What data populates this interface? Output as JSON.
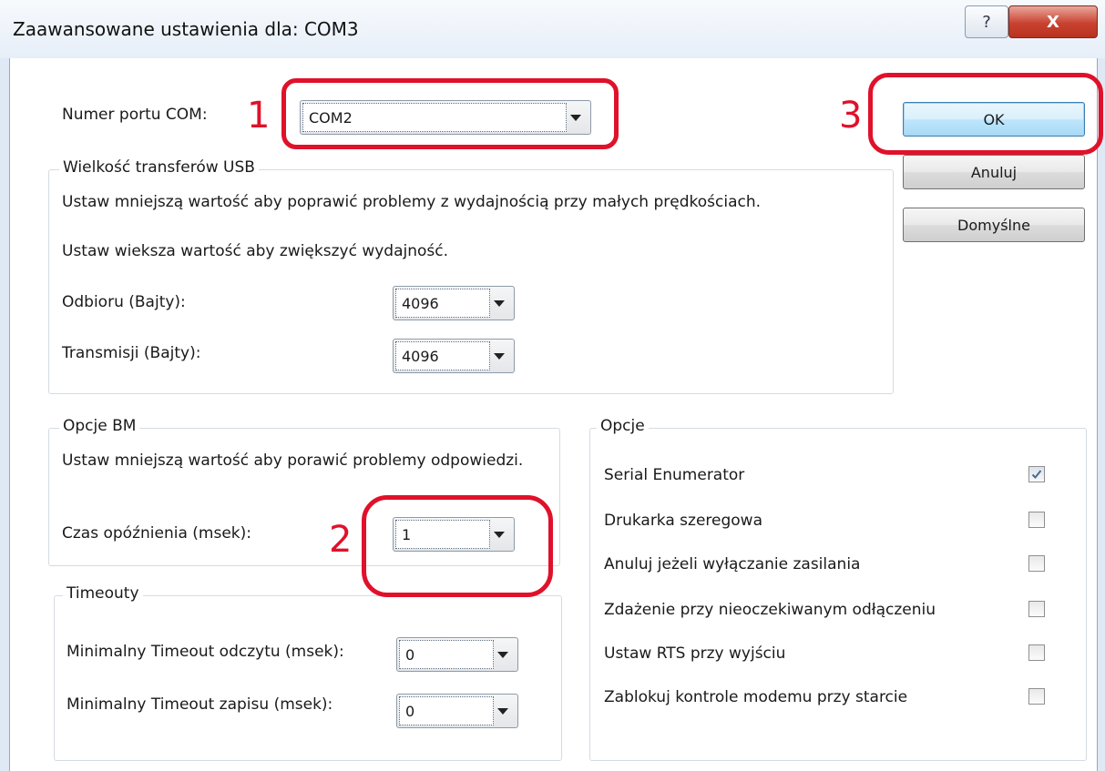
{
  "window": {
    "title": "Zaawansowane ustawienia dla: COM3",
    "help_label": "?",
    "close_label": "X"
  },
  "com_port": {
    "label": "Numer portu COM:",
    "value": "COM2"
  },
  "usb_transfer": {
    "legend": "Wielkość transferów USB",
    "hint_small": "Ustaw mniejszą wartość aby poprawić problemy z wydajnością przy małych prędkościach.",
    "hint_large": "Ustaw wieksza wartość aby zwiększyć wydajność.",
    "receive_label": "Odbioru (Bajty):",
    "receive_value": "4096",
    "transmit_label": "Transmisji (Bajty):",
    "transmit_value": "4096"
  },
  "bm_options": {
    "legend": "Opcje BM",
    "hint": "Ustaw mniejszą wartość aby porawić problemy odpowiedzi.",
    "latency_label": "Czas opóźnienia (msek):",
    "latency_value": "1"
  },
  "timeouts": {
    "legend": "Timeouty",
    "read_label": "Minimalny Timeout odczytu (msek):",
    "read_value": "0",
    "write_label": "Minimalny Timeout zapisu (msek):",
    "write_value": "0"
  },
  "options": {
    "legend": "Opcje",
    "items": [
      {
        "label": "Serial Enumerator",
        "checked": true
      },
      {
        "label": "Drukarka szeregowa",
        "checked": false
      },
      {
        "label": "Anuluj jeżeli wyłączanie zasilania",
        "checked": false
      },
      {
        "label": "Zdażenie przy nieoczekiwanym odłączeniu",
        "checked": false
      },
      {
        "label": "Ustaw RTS przy wyjściu",
        "checked": false
      },
      {
        "label": "Zablokuj kontrole modemu przy starcie",
        "checked": false
      }
    ]
  },
  "buttons": {
    "ok": "OK",
    "cancel": "Anuluj",
    "defaults": "Domyślne"
  },
  "annotations": {
    "one": "1",
    "two": "2",
    "three": "3",
    "color": "#e0112a"
  }
}
